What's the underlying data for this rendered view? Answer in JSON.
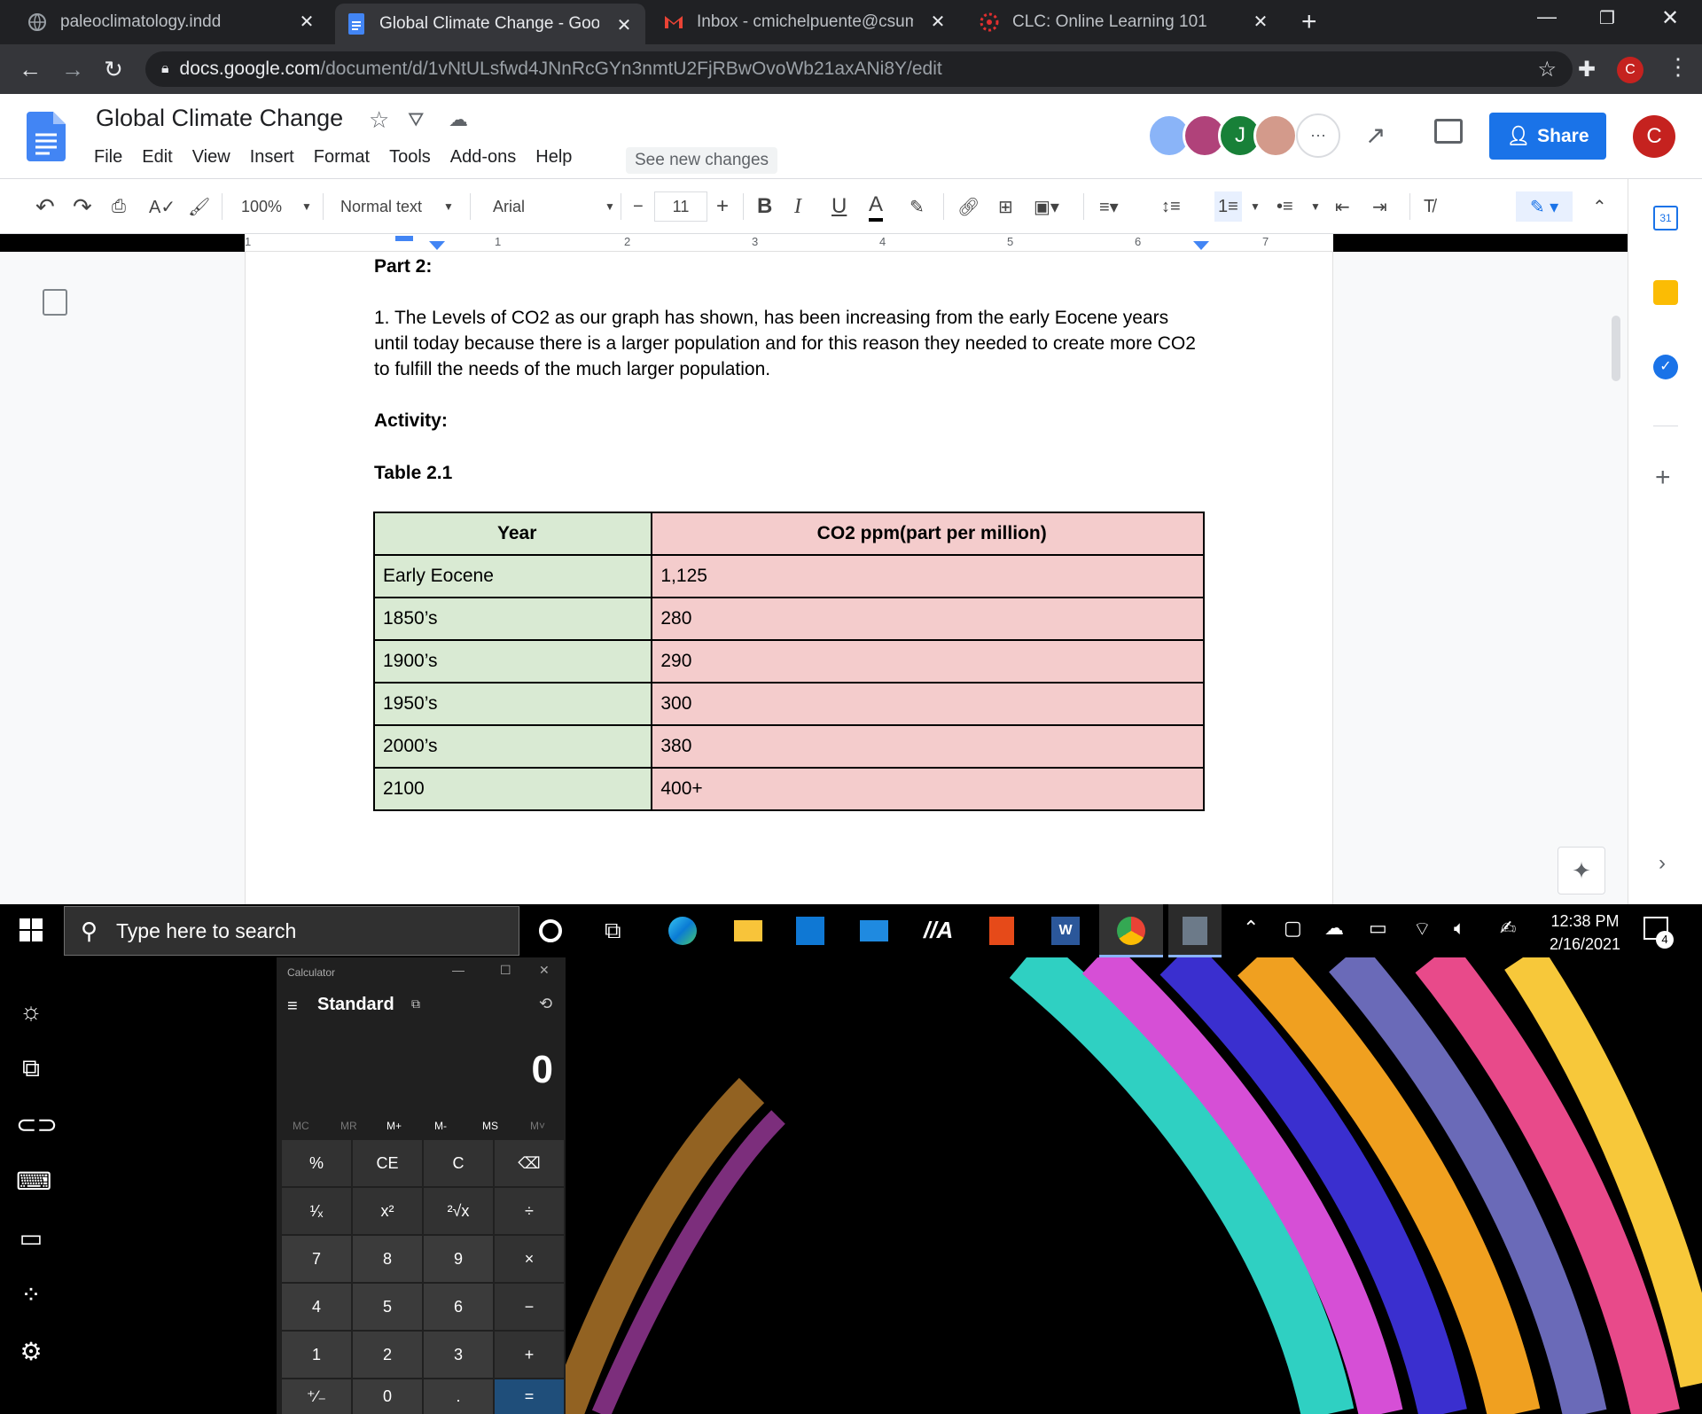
{
  "browser": {
    "tabs": [
      {
        "title": "paleoclimatology.indd",
        "icon": "globe-icon"
      },
      {
        "title": "Global Climate Change - Google",
        "icon": "google-docs-icon",
        "active": true
      },
      {
        "title": "Inbox - cmichelpuente@csumb.e",
        "icon": "gmail-icon"
      },
      {
        "title": "CLC: Online Learning 101",
        "icon": "canvas-icon"
      }
    ],
    "url_host": "docs.google.com",
    "url_path": "/document/d/1vNtULsfwd4JNnRcGYn3nmtU2FjRBwOvoWb21axANi8Y/edit",
    "profile_initial": "C"
  },
  "docs": {
    "title": "Global Climate Change",
    "menu": [
      "File",
      "Edit",
      "View",
      "Insert",
      "Format",
      "Tools",
      "Add-ons",
      "Help"
    ],
    "see_new_changes": "See new changes",
    "share_label": "Share",
    "collaborator_initial": "J",
    "user_initial": "C",
    "toolbar": {
      "zoom": "100%",
      "style": "Normal text",
      "font": "Arial",
      "font_size": "11"
    },
    "ruler_numbers": [
      "1",
      "1",
      "2",
      "3",
      "4",
      "5",
      "6",
      "7"
    ]
  },
  "document": {
    "part_heading": "Part 2:",
    "paragraph": "1. The Levels of CO2 as our graph has shown, has been increasing from the early Eocene years until today because there is a larger population and for this reason they needed to create more CO2 to fulfill the needs of the much larger population.",
    "activity_heading": "Activity:",
    "table_caption": "Table 2.1",
    "table": {
      "headers": [
        "Year",
        "CO2 ppm(part per million)"
      ],
      "rows": [
        [
          "Early Eocene",
          "1,125"
        ],
        [
          "1850’s",
          "280"
        ],
        [
          "1900’s",
          "290"
        ],
        [
          "1950’s",
          "300"
        ],
        [
          "2000’s",
          "380"
        ],
        [
          "2100",
          "400+"
        ]
      ]
    },
    "colors": {
      "year_col": "#d9ead3",
      "ppm_col": "#f4cccc"
    }
  },
  "taskbar": {
    "search_placeholder": "Type here to search",
    "time": "12:38 PM",
    "date": "2/16/2021",
    "notification_count": "4"
  },
  "calculator": {
    "window_title": "Calculator",
    "mode": "Standard",
    "display": "0",
    "memory": [
      "MC",
      "MR",
      "M+",
      "M-",
      "MS",
      "M˅"
    ],
    "keys": [
      [
        "%",
        "CE",
        "C",
        "⌫"
      ],
      [
        "¹⁄ₓ",
        "x²",
        "²√x",
        "÷"
      ],
      [
        "7",
        "8",
        "9",
        "×"
      ],
      [
        "4",
        "5",
        "6",
        "−"
      ],
      [
        "1",
        "2",
        "3",
        "+"
      ],
      [
        "⁺∕₋",
        "0",
        ".",
        "="
      ]
    ]
  }
}
